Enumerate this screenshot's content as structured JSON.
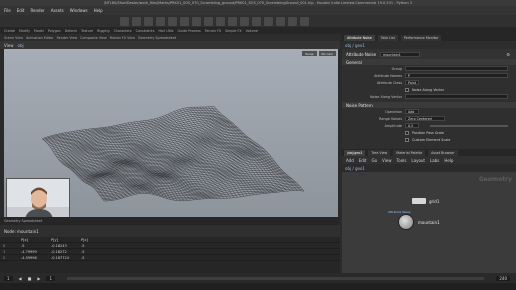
{
  "window": {
    "title": "/NTL60/ShortDealer/work_files/Maths/PRK01_SOS_070_Scrambling_ground/PRK01_SOS_070_ScramblingGround_001.hip - Houdini Indie Limited-Commercial 19.0.531 - Python 3"
  },
  "menubar": {
    "items": [
      "File",
      "Edit",
      "Render",
      "Assets",
      "Windows",
      "Help"
    ]
  },
  "shelf_tabs": [
    "Create",
    "Modify",
    "Model",
    "Polygon",
    "Deform",
    "Texture",
    "Rigging",
    "Characters",
    "Constraints",
    "Hair Utils",
    "Guide Process",
    "Terrain FX",
    "Simple FX",
    "Volume"
  ],
  "left_pane": {
    "tabs": [
      "Scene View",
      "Animation Editor",
      "Render View",
      "Composite View",
      "Motion FX View",
      "Geometry Spreadsheet"
    ],
    "path": "obj",
    "viewport_label": "View",
    "view_buttons": [
      "Persp",
      "No cam"
    ],
    "timeline_label": "Geometry Spreadsheet",
    "node_label": "Node: mountain1",
    "table": {
      "columns": [
        "P[x]",
        "P[y]",
        "P[z]"
      ],
      "rows": [
        {
          "idx": "0",
          "values": [
            "-5",
            "-0.18243",
            "-5"
          ]
        },
        {
          "idx": "1",
          "values": [
            "-4.79999",
            "-0.18272",
            "-5"
          ]
        },
        {
          "idx": "2",
          "values": [
            "-4.59998",
            "-0.187724",
            "-5"
          ]
        }
      ]
    },
    "playbar": {
      "frame_start": "1",
      "frame_current": "1",
      "frame_end": "240"
    }
  },
  "right_pane": {
    "tabs": [
      "Attribute Noise",
      "Take List",
      "Performance Monitor"
    ],
    "path": "obj / geo1",
    "node_type": "Attribute Noise",
    "node_name": "mountain1",
    "params": {
      "section_general": "General",
      "rows": [
        {
          "label": "Group",
          "value": ""
        },
        {
          "label": "Attribute Names",
          "value": "P"
        },
        {
          "label": "Attribute Class",
          "value": "Point"
        },
        {
          "label": "Noise Along Vector",
          "value": ""
        }
      ],
      "checkbox_label": "Noise Along Vector",
      "section_noise": "Noise Pattern",
      "noise_rows": [
        {
          "label": "Operation",
          "value": "Add"
        },
        {
          "label": "Range Values",
          "value": "Zero Centered"
        },
        {
          "label": "Amplitude",
          "value": "0.5"
        }
      ],
      "checks": [
        "Position Pass Scale",
        "Custom Element Scale"
      ]
    },
    "network": {
      "tabs": [
        "/obj/geo1",
        "Tree View",
        "Material Palette",
        "Asset Browser"
      ],
      "menu": [
        "Add",
        "Edit",
        "Go",
        "View",
        "Tools",
        "Layout",
        "Labs",
        "Help"
      ],
      "path": "obj / geo1",
      "watermark": "Geometry",
      "nodes": [
        {
          "name": "grid1"
        },
        {
          "name": "mountain1",
          "type": "Attribute Noise"
        }
      ]
    }
  },
  "colors": {
    "viewport_bg": "#9aa0a8",
    "accent_node": "#8fc3ff"
  }
}
